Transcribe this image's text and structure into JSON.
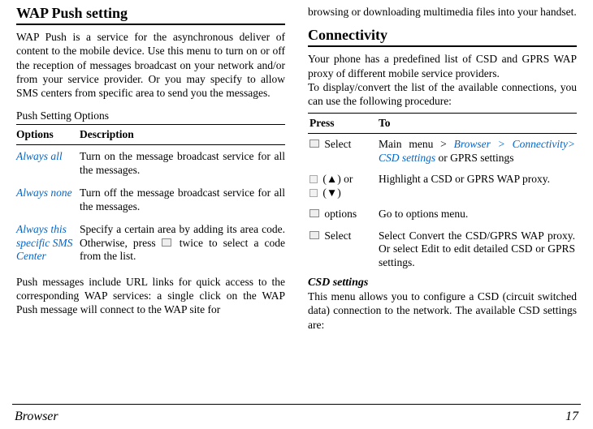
{
  "left": {
    "heading": "WAP Push setting",
    "intro": "WAP Push is a service for the asynchronous deliver of content to the mobile device. Use this menu to turn on or off the reception of messages broadcast on your network and/or from your service provider. Or you may specify to allow SMS centers from specific area to send you the messages.",
    "subhead": "Push Setting Options",
    "th1": "Options",
    "th2": "Description",
    "rows": {
      "r0": {
        "label": "Always all",
        "desc": "Turn on the message broadcast service for all the messages."
      },
      "r1": {
        "label": "Always none",
        "desc": "Turn off the message broadcast service for all the messages."
      },
      "r2": {
        "label": "Always this specific SMS Center",
        "desc_a": "Specify a certain area by adding its area code. Otherwise, press ",
        "desc_b": " twice to select a code from the list."
      }
    },
    "after": "Push messages include URL links for quick access to the corresponding WAP services: a single click on the WAP Push message will connect to the WAP site for"
  },
  "right": {
    "cont": "browsing or downloading multimedia files into your handset.",
    "heading": "Connectivity",
    "intro": "Your phone has a predefined list of CSD and GPRS WAP proxy of different mobile service providers.\nTo display/convert the list of the available connections, you can use the following procedure:",
    "th1": "Press",
    "th2": "To",
    "rows": {
      "r0": {
        "press": " Select",
        "to_a": "Main menu > ",
        "to_link": "Browser > Connectivity> CSD settings",
        "to_b": " or GPRS settings"
      },
      "r1": {
        "press_a": " (▲) or ",
        "press_b": " (▼)",
        "to": "Highlight a CSD or GPRS WAP proxy."
      },
      "r2": {
        "press": " options",
        "to": "Go to options menu."
      },
      "r3": {
        "press": " Select",
        "to": "Select Convert the CSD/GPRS WAP proxy. Or select Edit to edit detailed CSD or GPRS settings."
      }
    },
    "csd_heading": "CSD settings",
    "csd_body": "This menu allows you to configure a CSD (circuit switched data) connection to the network. The available CSD settings are:"
  },
  "footer": {
    "left": "Browser",
    "right": "17"
  }
}
